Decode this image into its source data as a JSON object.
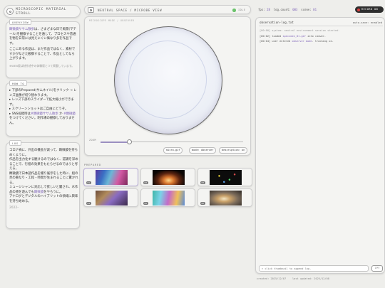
{
  "app": {
    "title_line1": "MICROSCOPIC MATERIAL",
    "title_line2": "STROLL"
  },
  "overview": {
    "title": "OVERVIEW",
    "p1_parts": [
      "顕微鏡ササム散歩",
      "は、さまざまな日で風景(マテール)を観察することを通して、プロセスや普通を物を日常には見えにくい価なり多を作品です。"
    ],
    "p2": "ここにある作品は、まだ作品ではなく、素材ですかがなさた観察することで、作品としてなら上がります。",
    "note": "※WEB版は制作途中の体験版とつて掲載しています。"
  },
  "howto": {
    "title": "HOW TO",
    "items": [
      "下部のPrepared(サムネイル)をクリック → レンズ画像が切り替わります。",
      "レンズ下部のスライダーで拡大縮小ができます。",
      "スクリーンショットはご自由にどうぞ。"
    ],
    "item4_parts": [
      "SNS投稿時は",
      "#顕微鏡ササム散歩",
      "か",
      "#顕微鏡",
      "をつけてください。制作場の観察しておりません。"
    ]
  },
  "log": {
    "title": "LOG",
    "items": [
      "コロナ禍に、外出の機会が減って、顕微鏡を持ちめくように。",
      "作品を出力化する観けるのではなく、認識を深めることで、行程の効果をもたらせるのではうと考える。",
      "顕微鏡で日本語作品を撮り展示をした時に、組の見の重なり・工程・時間が生まれることに驚かれる。",
      "ミュージシャンに対応して欲しいと聞され、水作品の液を遊んでも顕微鏡をやろうに。",
      "アナログとデジタルのハイブリットの領域に興味を持ち始める。"
    ],
    "highlight_word": "顕微鏡",
    "end": "2022–"
  },
  "topbar": {
    "label": "NEUTRAL SPACE / MICROBE VIEW",
    "status": "IDLE"
  },
  "lens": {
    "mode_label": "MICROSCOPE MODE / OBSERVER",
    "zoom_label": "ZOOM",
    "zoom_value": 0.2
  },
  "tags": [
    "micro.gif",
    "mode: observer",
    "description: on"
  ],
  "prepared": {
    "title": "PREPARED",
    "items": [
      {
        "num": "01"
      },
      {
        "num": "02"
      },
      {
        "num": "03"
      },
      {
        "num": "04"
      },
      {
        "num": "05"
      },
      {
        "num": "06"
      }
    ]
  },
  "stats": {
    "fps_label": "fps:",
    "fps_value": "28",
    "log_label": "log.count:",
    "log_value": "003",
    "scene_label": "scene:",
    "scene_value": "01"
  },
  "rec_button": "RECORD ON",
  "console": {
    "file": "observation-log.txt",
    "autosave": "auto-save: enabled",
    "lines": [
      {
        "ts": "[00:00]",
        "pre": "system: neutral environment session started.",
        "hl": "",
        "post": ""
      },
      {
        "ts": "[00:02]",
        "pre": "loaded ",
        "hl": "specimen_01.gif",
        "post": " into viewer."
      },
      {
        "ts": "[00:04]",
        "pre": "user entered ",
        "hl": "observer mode",
        "post": ". tracking on."
      }
    ],
    "input_placeholder": "> click thumbnail to append log.",
    "enter_label": "???"
  },
  "footer": {
    "created": "created: 2025/12/07",
    "updated": "last updated: 2025/12/08"
  },
  "colors": {
    "bg": "#eeeeeb",
    "accent": "#7e63b8",
    "rec": "#c33333",
    "status": "#6cc36c"
  }
}
